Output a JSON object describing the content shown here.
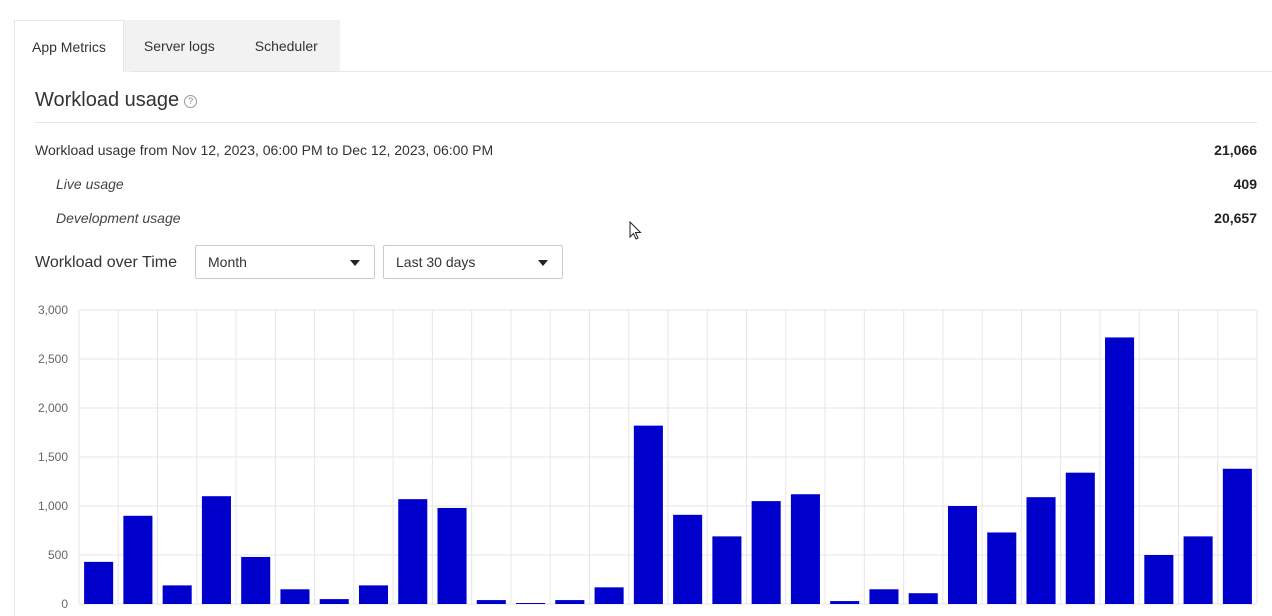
{
  "tabs": [
    {
      "label": "App Metrics",
      "active": true
    },
    {
      "label": "Server logs",
      "active": false
    },
    {
      "label": "Scheduler",
      "active": false
    }
  ],
  "section": {
    "title": "Workload usage",
    "help_icon": "help-circle-icon",
    "help_glyph": "?"
  },
  "usage": {
    "range_label": "Workload usage from Nov 12, 2023, 06:00 PM to Dec 12, 2023, 06:00 PM",
    "total": "21,066",
    "live_label": "Live usage",
    "live_value": "409",
    "dev_label": "Development usage",
    "dev_value": "20,657"
  },
  "controls": {
    "label": "Workload over Time",
    "granularity": "Month",
    "period": "Last 30 days"
  },
  "colors": {
    "bar": "#0000cc",
    "grid": "#e6e6e6"
  },
  "chart_data": {
    "type": "bar",
    "ylim": [
      0,
      3000
    ],
    "yticks": [
      "0",
      "500",
      "1,000",
      "1,500",
      "2,000",
      "2,500",
      "3,000"
    ],
    "ytick_values": [
      0,
      500,
      1000,
      1500,
      2000,
      2500,
      3000
    ],
    "values": [
      430,
      900,
      190,
      1100,
      480,
      150,
      50,
      190,
      1070,
      980,
      40,
      10,
      40,
      170,
      1820,
      910,
      690,
      1050,
      1120,
      30,
      150,
      110,
      1000,
      730,
      1090,
      1340,
      2720,
      500,
      690,
      1380
    ],
    "grid": true,
    "title": "",
    "xlabel": "",
    "ylabel": ""
  }
}
